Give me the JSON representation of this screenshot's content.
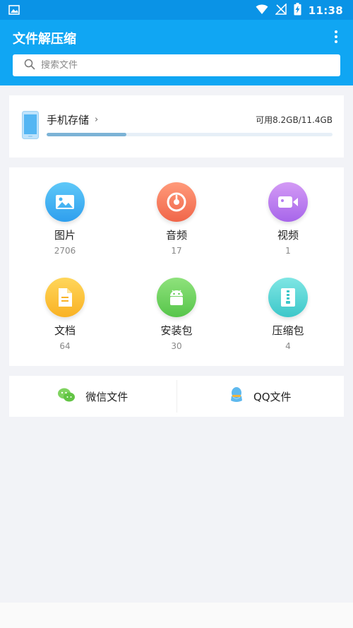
{
  "status_bar": {
    "time": "11:38",
    "icons": [
      "image-icon",
      "wifi-icon",
      "signal-off-icon",
      "battery-charging-icon"
    ]
  },
  "app_bar": {
    "title": "文件解压缩",
    "menu_icon": "more-vert-icon"
  },
  "search": {
    "placeholder": "搜索文件",
    "icon": "search-icon"
  },
  "storage": {
    "title": "手机存储",
    "chevron": "›",
    "usage": "可用8.2GB/11.4GB",
    "used_fraction": 0.28
  },
  "categories": [
    {
      "label": "图片",
      "count": "2706",
      "icon": "image-icon",
      "color_top": "#5ec8f8",
      "color_bottom": "#2f9fee"
    },
    {
      "label": "音频",
      "count": "17",
      "icon": "music-disc-icon",
      "color_top": "#ff9a7a",
      "color_bottom": "#f0664a"
    },
    {
      "label": "视频",
      "count": "1",
      "icon": "video-camera-icon",
      "color_top": "#d39af5",
      "color_bottom": "#a766ea"
    },
    {
      "label": "文档",
      "count": "64",
      "icon": "document-icon",
      "color_top": "#ffd65a",
      "color_bottom": "#f9b224"
    },
    {
      "label": "安装包",
      "count": "30",
      "icon": "android-icon",
      "color_top": "#8fe27c",
      "color_bottom": "#56c54a"
    },
    {
      "label": "压缩包",
      "count": "4",
      "icon": "zip-archive-icon",
      "color_top": "#7fe6e4",
      "color_bottom": "#3cc7c9"
    }
  ],
  "quick_links": [
    {
      "label": "微信文件",
      "icon": "wechat-icon"
    },
    {
      "label": "QQ文件",
      "icon": "qq-icon"
    }
  ]
}
